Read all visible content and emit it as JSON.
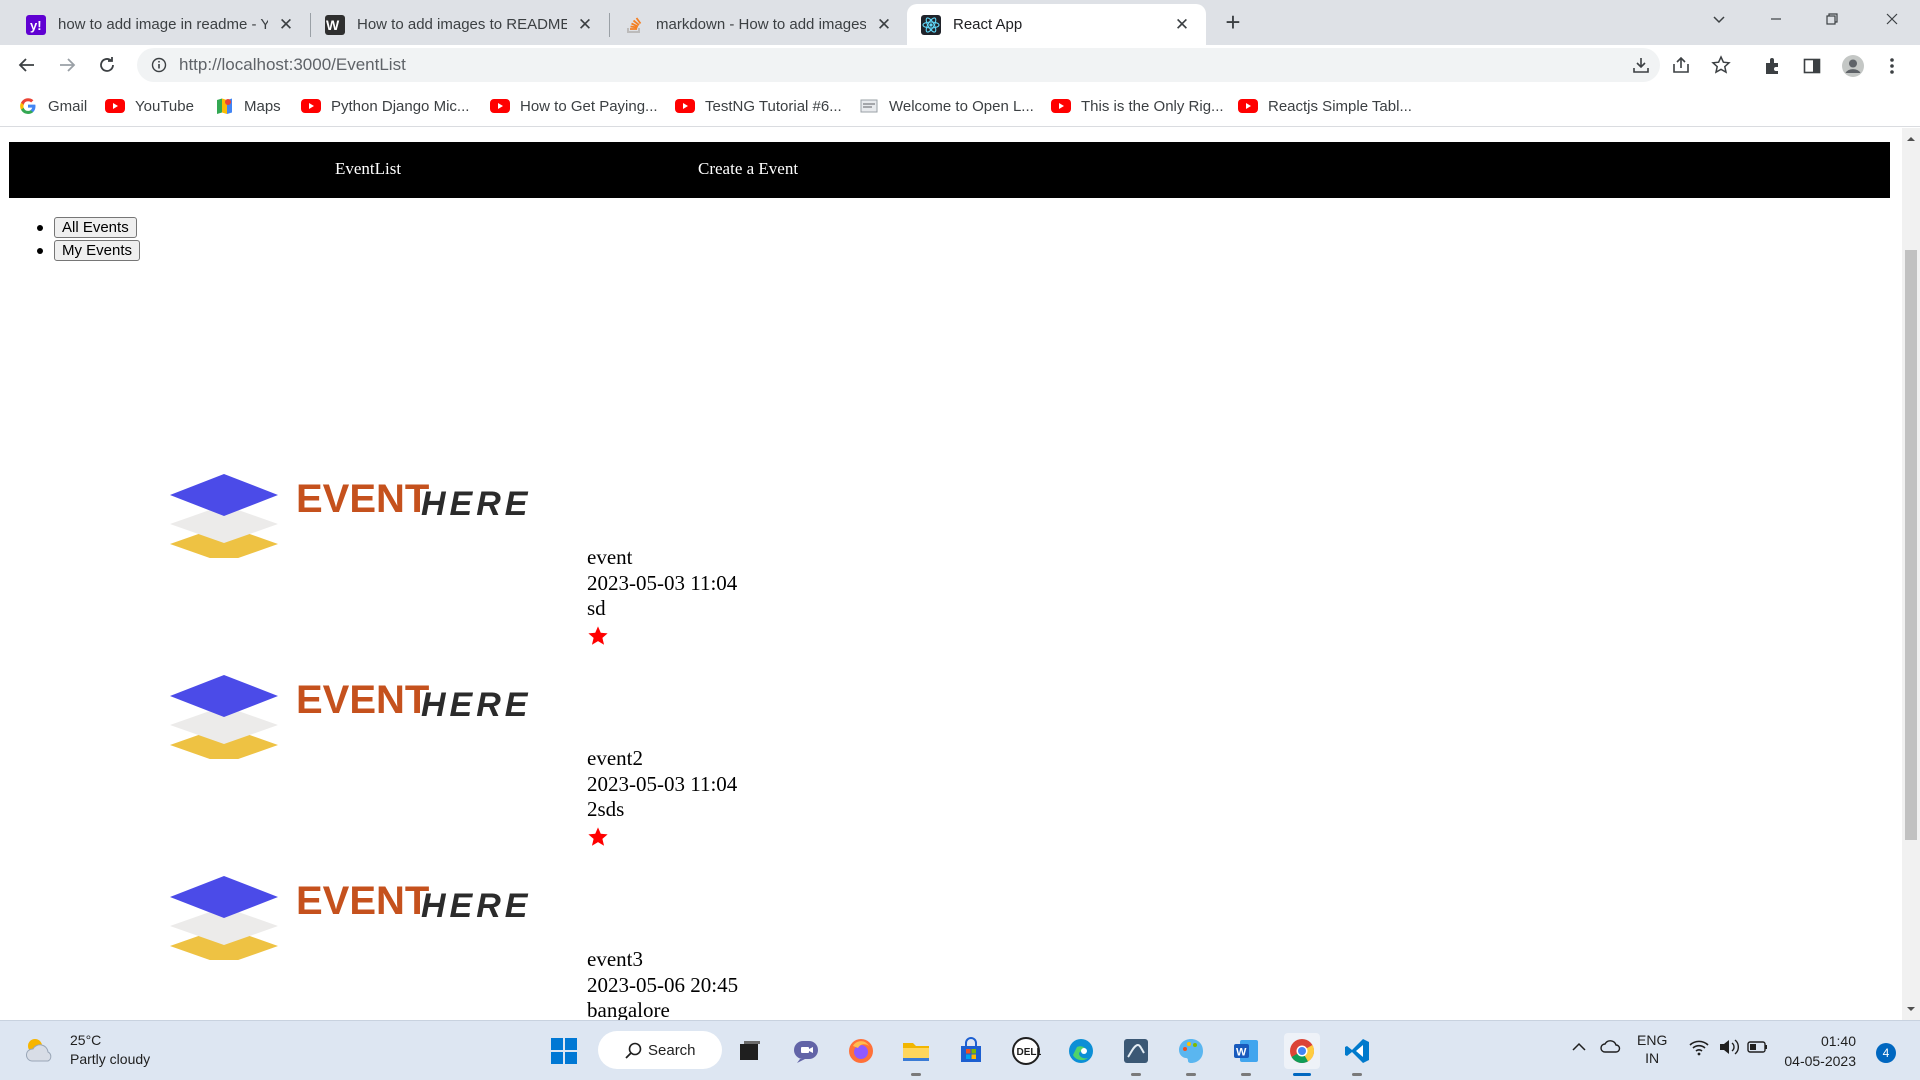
{
  "browser": {
    "tabs": [
      {
        "title": "how to add image in readme - Ya",
        "icon": "yahoo-icon",
        "active": false
      },
      {
        "title": "How to add images to README.m",
        "icon": "wikihow-icon",
        "active": false
      },
      {
        "title": "markdown - How to add images",
        "icon": "stackoverflow-icon",
        "active": false
      },
      {
        "title": "React App",
        "icon": "react-icon",
        "active": true
      }
    ],
    "new_tab": "+",
    "url": "http://localhost:3000/EventList",
    "bookmarks": [
      {
        "label": "Gmail",
        "icon": "google-icon"
      },
      {
        "label": "YouTube",
        "icon": "youtube-icon"
      },
      {
        "label": "Maps",
        "icon": "maps-icon"
      },
      {
        "label": "Python Django Mic...",
        "icon": "youtube-icon"
      },
      {
        "label": "How to Get Paying...",
        "icon": "youtube-icon"
      },
      {
        "label": "TestNG Tutorial #6...",
        "icon": "youtube-icon"
      },
      {
        "label": "Welcome to Open L...",
        "icon": "page-icon"
      },
      {
        "label": "This is the Only Rig...",
        "icon": "youtube-icon"
      },
      {
        "label": "Reactjs Simple Tabl...",
        "icon": "youtube-icon"
      }
    ]
  },
  "app": {
    "nav": {
      "eventlist": "EventList",
      "create": "Create a Event"
    },
    "filters": {
      "all": "All Events",
      "mine": "My Events"
    },
    "logo": {
      "word1": "EVENT",
      "word2": "HERE"
    },
    "events": [
      {
        "name": "event",
        "datetime": "2023-05-03 11:04",
        "location": "sd"
      },
      {
        "name": "event2",
        "datetime": "2023-05-03 11:04",
        "location": "2sds"
      },
      {
        "name": "event3",
        "datetime": "2023-05-06 20:45",
        "location": "bangalore"
      }
    ],
    "colors": {
      "nav_bg": "#000000",
      "star": "#ff0000",
      "logo_blue": "#4b4be8",
      "logo_orange": "#c5511d",
      "logo_gold": "#eec243"
    }
  },
  "taskbar": {
    "weather": {
      "temp": "25°C",
      "condition": "Partly cloudy"
    },
    "search_label": "Search",
    "language": {
      "line1": "ENG",
      "line2": "IN"
    },
    "time": "01:40",
    "date": "04-05-2023",
    "notifications": "4"
  }
}
